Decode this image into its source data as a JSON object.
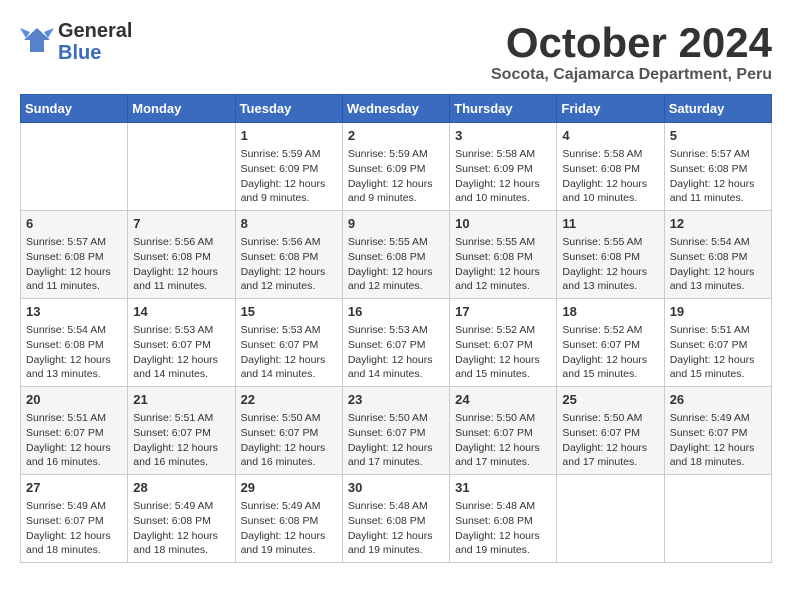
{
  "logo": {
    "line1": "General",
    "line2": "Blue"
  },
  "title": "October 2024",
  "location": "Socota, Cajamarca Department, Peru",
  "days_of_week": [
    "Sunday",
    "Monday",
    "Tuesday",
    "Wednesday",
    "Thursday",
    "Friday",
    "Saturday"
  ],
  "weeks": [
    [
      {
        "day": "",
        "sunrise": "",
        "sunset": "",
        "daylight": ""
      },
      {
        "day": "",
        "sunrise": "",
        "sunset": "",
        "daylight": ""
      },
      {
        "day": "1",
        "sunrise": "Sunrise: 5:59 AM",
        "sunset": "Sunset: 6:09 PM",
        "daylight": "Daylight: 12 hours and 9 minutes."
      },
      {
        "day": "2",
        "sunrise": "Sunrise: 5:59 AM",
        "sunset": "Sunset: 6:09 PM",
        "daylight": "Daylight: 12 hours and 9 minutes."
      },
      {
        "day": "3",
        "sunrise": "Sunrise: 5:58 AM",
        "sunset": "Sunset: 6:09 PM",
        "daylight": "Daylight: 12 hours and 10 minutes."
      },
      {
        "day": "4",
        "sunrise": "Sunrise: 5:58 AM",
        "sunset": "Sunset: 6:08 PM",
        "daylight": "Daylight: 12 hours and 10 minutes."
      },
      {
        "day": "5",
        "sunrise": "Sunrise: 5:57 AM",
        "sunset": "Sunset: 6:08 PM",
        "daylight": "Daylight: 12 hours and 11 minutes."
      }
    ],
    [
      {
        "day": "6",
        "sunrise": "Sunrise: 5:57 AM",
        "sunset": "Sunset: 6:08 PM",
        "daylight": "Daylight: 12 hours and 11 minutes."
      },
      {
        "day": "7",
        "sunrise": "Sunrise: 5:56 AM",
        "sunset": "Sunset: 6:08 PM",
        "daylight": "Daylight: 12 hours and 11 minutes."
      },
      {
        "day": "8",
        "sunrise": "Sunrise: 5:56 AM",
        "sunset": "Sunset: 6:08 PM",
        "daylight": "Daylight: 12 hours and 12 minutes."
      },
      {
        "day": "9",
        "sunrise": "Sunrise: 5:55 AM",
        "sunset": "Sunset: 6:08 PM",
        "daylight": "Daylight: 12 hours and 12 minutes."
      },
      {
        "day": "10",
        "sunrise": "Sunrise: 5:55 AM",
        "sunset": "Sunset: 6:08 PM",
        "daylight": "Daylight: 12 hours and 12 minutes."
      },
      {
        "day": "11",
        "sunrise": "Sunrise: 5:55 AM",
        "sunset": "Sunset: 6:08 PM",
        "daylight": "Daylight: 12 hours and 13 minutes."
      },
      {
        "day": "12",
        "sunrise": "Sunrise: 5:54 AM",
        "sunset": "Sunset: 6:08 PM",
        "daylight": "Daylight: 12 hours and 13 minutes."
      }
    ],
    [
      {
        "day": "13",
        "sunrise": "Sunrise: 5:54 AM",
        "sunset": "Sunset: 6:08 PM",
        "daylight": "Daylight: 12 hours and 13 minutes."
      },
      {
        "day": "14",
        "sunrise": "Sunrise: 5:53 AM",
        "sunset": "Sunset: 6:07 PM",
        "daylight": "Daylight: 12 hours and 14 minutes."
      },
      {
        "day": "15",
        "sunrise": "Sunrise: 5:53 AM",
        "sunset": "Sunset: 6:07 PM",
        "daylight": "Daylight: 12 hours and 14 minutes."
      },
      {
        "day": "16",
        "sunrise": "Sunrise: 5:53 AM",
        "sunset": "Sunset: 6:07 PM",
        "daylight": "Daylight: 12 hours and 14 minutes."
      },
      {
        "day": "17",
        "sunrise": "Sunrise: 5:52 AM",
        "sunset": "Sunset: 6:07 PM",
        "daylight": "Daylight: 12 hours and 15 minutes."
      },
      {
        "day": "18",
        "sunrise": "Sunrise: 5:52 AM",
        "sunset": "Sunset: 6:07 PM",
        "daylight": "Daylight: 12 hours and 15 minutes."
      },
      {
        "day": "19",
        "sunrise": "Sunrise: 5:51 AM",
        "sunset": "Sunset: 6:07 PM",
        "daylight": "Daylight: 12 hours and 15 minutes."
      }
    ],
    [
      {
        "day": "20",
        "sunrise": "Sunrise: 5:51 AM",
        "sunset": "Sunset: 6:07 PM",
        "daylight": "Daylight: 12 hours and 16 minutes."
      },
      {
        "day": "21",
        "sunrise": "Sunrise: 5:51 AM",
        "sunset": "Sunset: 6:07 PM",
        "daylight": "Daylight: 12 hours and 16 minutes."
      },
      {
        "day": "22",
        "sunrise": "Sunrise: 5:50 AM",
        "sunset": "Sunset: 6:07 PM",
        "daylight": "Daylight: 12 hours and 16 minutes."
      },
      {
        "day": "23",
        "sunrise": "Sunrise: 5:50 AM",
        "sunset": "Sunset: 6:07 PM",
        "daylight": "Daylight: 12 hours and 17 minutes."
      },
      {
        "day": "24",
        "sunrise": "Sunrise: 5:50 AM",
        "sunset": "Sunset: 6:07 PM",
        "daylight": "Daylight: 12 hours and 17 minutes."
      },
      {
        "day": "25",
        "sunrise": "Sunrise: 5:50 AM",
        "sunset": "Sunset: 6:07 PM",
        "daylight": "Daylight: 12 hours and 17 minutes."
      },
      {
        "day": "26",
        "sunrise": "Sunrise: 5:49 AM",
        "sunset": "Sunset: 6:07 PM",
        "daylight": "Daylight: 12 hours and 18 minutes."
      }
    ],
    [
      {
        "day": "27",
        "sunrise": "Sunrise: 5:49 AM",
        "sunset": "Sunset: 6:07 PM",
        "daylight": "Daylight: 12 hours and 18 minutes."
      },
      {
        "day": "28",
        "sunrise": "Sunrise: 5:49 AM",
        "sunset": "Sunset: 6:08 PM",
        "daylight": "Daylight: 12 hours and 18 minutes."
      },
      {
        "day": "29",
        "sunrise": "Sunrise: 5:49 AM",
        "sunset": "Sunset: 6:08 PM",
        "daylight": "Daylight: 12 hours and 19 minutes."
      },
      {
        "day": "30",
        "sunrise": "Sunrise: 5:48 AM",
        "sunset": "Sunset: 6:08 PM",
        "daylight": "Daylight: 12 hours and 19 minutes."
      },
      {
        "day": "31",
        "sunrise": "Sunrise: 5:48 AM",
        "sunset": "Sunset: 6:08 PM",
        "daylight": "Daylight: 12 hours and 19 minutes."
      },
      {
        "day": "",
        "sunrise": "",
        "sunset": "",
        "daylight": ""
      },
      {
        "day": "",
        "sunrise": "",
        "sunset": "",
        "daylight": ""
      }
    ]
  ]
}
